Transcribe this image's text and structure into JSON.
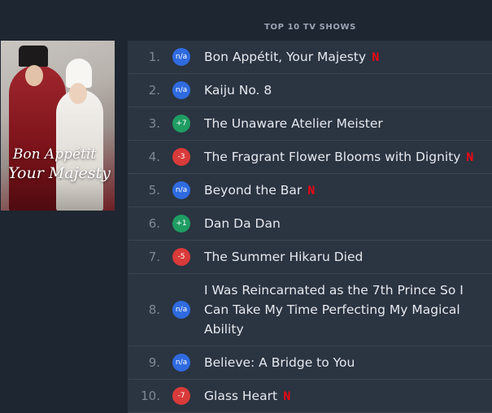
{
  "section_title": "TOP 10 TV SHOWS",
  "poster": {
    "title_line1": "Bon Appétit",
    "title_line2": "Your Majesty"
  },
  "netflix_icon": "N",
  "colors": {
    "new": "#2f6be0",
    "up": "#1f9d63",
    "down": "#d93a3a",
    "netflix": "#e50914"
  },
  "shows": [
    {
      "rank": "1.",
      "change": "n/a",
      "title": "Bon Appétit, Your Majesty",
      "netflix": true
    },
    {
      "rank": "2.",
      "change": "n/a",
      "title": "Kaiju No. 8",
      "netflix": false
    },
    {
      "rank": "3.",
      "change": "+7",
      "title": "The Unaware Atelier Meister",
      "netflix": false
    },
    {
      "rank": "4.",
      "change": "-3",
      "title": "The Fragrant Flower Blooms with Dignity",
      "netflix": true
    },
    {
      "rank": "5.",
      "change": "n/a",
      "title": "Beyond the Bar",
      "netflix": true
    },
    {
      "rank": "6.",
      "change": "+1",
      "title": "Dan Da Dan",
      "netflix": false
    },
    {
      "rank": "7.",
      "change": "-5",
      "title": "The Summer Hikaru Died",
      "netflix": false
    },
    {
      "rank": "8.",
      "change": "n/a",
      "title": "I Was Reincarnated as the 7th Prince So I Can Take My Time Perfecting My Magical Ability",
      "netflix": false
    },
    {
      "rank": "9.",
      "change": "n/a",
      "title": "Believe: A Bridge to You",
      "netflix": false
    },
    {
      "rank": "10.",
      "change": "-7",
      "title": "Glass Heart",
      "netflix": true
    }
  ]
}
